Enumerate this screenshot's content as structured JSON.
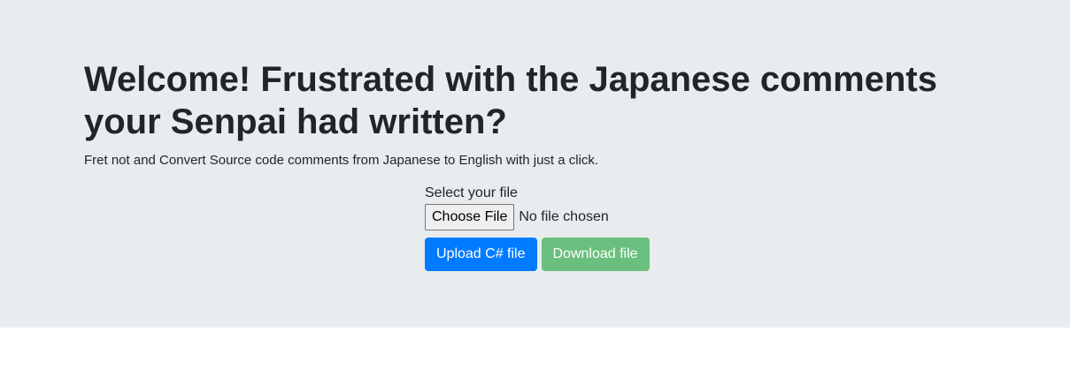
{
  "header": {
    "title": "Welcome! Frustrated with the Japanese comments your Senpai had written?",
    "lead": "Fret not and Convert Source code comments from Japanese to English with just a click."
  },
  "form": {
    "label": "Select your file",
    "choose_label": "Choose File",
    "no_file_text": "No file chosen",
    "upload_label": "Upload C# file",
    "download_label": "Download file"
  },
  "colors": {
    "jumbotron_bg": "#e9ecef",
    "primary": "#007bff",
    "success_disabled": "#6bbf7e"
  }
}
